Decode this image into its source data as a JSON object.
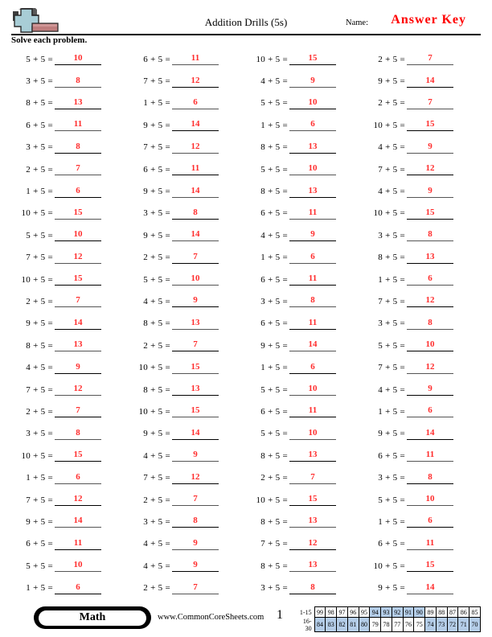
{
  "header": {
    "title": "Addition Drills (5s)",
    "name_label": "Name:",
    "name_value": "Answer Key",
    "instruction": "Solve each problem.",
    "logo_icon": "plus-block-icon",
    "answer_color": "#ff2d2d"
  },
  "problems": [
    {
      "q": "5 + 5 =",
      "a": "10"
    },
    {
      "q": "3 + 5 =",
      "a": "8"
    },
    {
      "q": "8 + 5 =",
      "a": "13"
    },
    {
      "q": "6 + 5 =",
      "a": "11"
    },
    {
      "q": "3 + 5 =",
      "a": "8"
    },
    {
      "q": "2 + 5 =",
      "a": "7"
    },
    {
      "q": "1 + 5 =",
      "a": "6"
    },
    {
      "q": "10 + 5 =",
      "a": "15"
    },
    {
      "q": "5 + 5 =",
      "a": "10"
    },
    {
      "q": "7 + 5 =",
      "a": "12"
    },
    {
      "q": "10 + 5 =",
      "a": "15"
    },
    {
      "q": "2 + 5 =",
      "a": "7"
    },
    {
      "q": "9 + 5 =",
      "a": "14"
    },
    {
      "q": "8 + 5 =",
      "a": "13"
    },
    {
      "q": "4 + 5 =",
      "a": "9"
    },
    {
      "q": "7 + 5 =",
      "a": "12"
    },
    {
      "q": "2 + 5 =",
      "a": "7"
    },
    {
      "q": "3 + 5 =",
      "a": "8"
    },
    {
      "q": "10 + 5 =",
      "a": "15"
    },
    {
      "q": "1 + 5 =",
      "a": "6"
    },
    {
      "q": "7 + 5 =",
      "a": "12"
    },
    {
      "q": "9 + 5 =",
      "a": "14"
    },
    {
      "q": "6 + 5 =",
      "a": "11"
    },
    {
      "q": "5 + 5 =",
      "a": "10"
    },
    {
      "q": "1 + 5 =",
      "a": "6"
    },
    {
      "q": "6 + 5 =",
      "a": "11"
    },
    {
      "q": "7 + 5 =",
      "a": "12"
    },
    {
      "q": "1 + 5 =",
      "a": "6"
    },
    {
      "q": "9 + 5 =",
      "a": "14"
    },
    {
      "q": "7 + 5 =",
      "a": "12"
    },
    {
      "q": "6 + 5 =",
      "a": "11"
    },
    {
      "q": "9 + 5 =",
      "a": "14"
    },
    {
      "q": "3 + 5 =",
      "a": "8"
    },
    {
      "q": "9 + 5 =",
      "a": "14"
    },
    {
      "q": "2 + 5 =",
      "a": "7"
    },
    {
      "q": "5 + 5 =",
      "a": "10"
    },
    {
      "q": "4 + 5 =",
      "a": "9"
    },
    {
      "q": "8 + 5 =",
      "a": "13"
    },
    {
      "q": "2 + 5 =",
      "a": "7"
    },
    {
      "q": "10 + 5 =",
      "a": "15"
    },
    {
      "q": "8 + 5 =",
      "a": "13"
    },
    {
      "q": "10 + 5 =",
      "a": "15"
    },
    {
      "q": "9 + 5 =",
      "a": "14"
    },
    {
      "q": "4 + 5 =",
      "a": "9"
    },
    {
      "q": "7 + 5 =",
      "a": "12"
    },
    {
      "q": "2 + 5 =",
      "a": "7"
    },
    {
      "q": "3 + 5 =",
      "a": "8"
    },
    {
      "q": "4 + 5 =",
      "a": "9"
    },
    {
      "q": "4 + 5 =",
      "a": "9"
    },
    {
      "q": "2 + 5 =",
      "a": "7"
    },
    {
      "q": "10 + 5 =",
      "a": "15"
    },
    {
      "q": "4 + 5 =",
      "a": "9"
    },
    {
      "q": "5 + 5 =",
      "a": "10"
    },
    {
      "q": "1 + 5 =",
      "a": "6"
    },
    {
      "q": "8 + 5 =",
      "a": "13"
    },
    {
      "q": "5 + 5 =",
      "a": "10"
    },
    {
      "q": "8 + 5 =",
      "a": "13"
    },
    {
      "q": "6 + 5 =",
      "a": "11"
    },
    {
      "q": "4 + 5 =",
      "a": "9"
    },
    {
      "q": "1 + 5 =",
      "a": "6"
    },
    {
      "q": "6 + 5 =",
      "a": "11"
    },
    {
      "q": "3 + 5 =",
      "a": "8"
    },
    {
      "q": "6 + 5 =",
      "a": "11"
    },
    {
      "q": "9 + 5 =",
      "a": "14"
    },
    {
      "q": "1 + 5 =",
      "a": "6"
    },
    {
      "q": "5 + 5 =",
      "a": "10"
    },
    {
      "q": "6 + 5 =",
      "a": "11"
    },
    {
      "q": "5 + 5 =",
      "a": "10"
    },
    {
      "q": "8 + 5 =",
      "a": "13"
    },
    {
      "q": "2 + 5 =",
      "a": "7"
    },
    {
      "q": "10 + 5 =",
      "a": "15"
    },
    {
      "q": "8 + 5 =",
      "a": "13"
    },
    {
      "q": "7 + 5 =",
      "a": "12"
    },
    {
      "q": "8 + 5 =",
      "a": "13"
    },
    {
      "q": "3 + 5 =",
      "a": "8"
    },
    {
      "q": "2 + 5 =",
      "a": "7"
    },
    {
      "q": "9 + 5 =",
      "a": "14"
    },
    {
      "q": "2 + 5 =",
      "a": "7"
    },
    {
      "q": "10 + 5 =",
      "a": "15"
    },
    {
      "q": "4 + 5 =",
      "a": "9"
    },
    {
      "q": "7 + 5 =",
      "a": "12"
    },
    {
      "q": "4 + 5 =",
      "a": "9"
    },
    {
      "q": "10 + 5 =",
      "a": "15"
    },
    {
      "q": "3 + 5 =",
      "a": "8"
    },
    {
      "q": "8 + 5 =",
      "a": "13"
    },
    {
      "q": "1 + 5 =",
      "a": "6"
    },
    {
      "q": "7 + 5 =",
      "a": "12"
    },
    {
      "q": "3 + 5 =",
      "a": "8"
    },
    {
      "q": "5 + 5 =",
      "a": "10"
    },
    {
      "q": "7 + 5 =",
      "a": "12"
    },
    {
      "q": "4 + 5 =",
      "a": "9"
    },
    {
      "q": "1 + 5 =",
      "a": "6"
    },
    {
      "q": "9 + 5 =",
      "a": "14"
    },
    {
      "q": "6 + 5 =",
      "a": "11"
    },
    {
      "q": "3 + 5 =",
      "a": "8"
    },
    {
      "q": "5 + 5 =",
      "a": "10"
    },
    {
      "q": "1 + 5 =",
      "a": "6"
    },
    {
      "q": "6 + 5 =",
      "a": "11"
    },
    {
      "q": "10 + 5 =",
      "a": "15"
    },
    {
      "q": "9 + 5 =",
      "a": "14"
    }
  ],
  "footer": {
    "subject_badge": "Math",
    "website": "www.CommonCoreSheets.com",
    "page_number": "1",
    "highlight_color": "#b4cde8",
    "score_rows": [
      {
        "label": "1-15",
        "cells": [
          {
            "v": "99",
            "hl": false
          },
          {
            "v": "98",
            "hl": false
          },
          {
            "v": "97",
            "hl": false
          },
          {
            "v": "96",
            "hl": false
          },
          {
            "v": "95",
            "hl": false
          },
          {
            "v": "94",
            "hl": true
          },
          {
            "v": "93",
            "hl": true
          },
          {
            "v": "92",
            "hl": true
          },
          {
            "v": "91",
            "hl": true
          },
          {
            "v": "90",
            "hl": true
          },
          {
            "v": "89",
            "hl": false
          },
          {
            "v": "88",
            "hl": false
          },
          {
            "v": "87",
            "hl": false
          },
          {
            "v": "86",
            "hl": false
          },
          {
            "v": "85",
            "hl": false
          }
        ]
      },
      {
        "label": "16-30",
        "cells": [
          {
            "v": "84",
            "hl": true
          },
          {
            "v": "83",
            "hl": true
          },
          {
            "v": "82",
            "hl": true
          },
          {
            "v": "81",
            "hl": true
          },
          {
            "v": "80",
            "hl": true
          },
          {
            "v": "79",
            "hl": false
          },
          {
            "v": "78",
            "hl": false
          },
          {
            "v": "77",
            "hl": false
          },
          {
            "v": "76",
            "hl": false
          },
          {
            "v": "75",
            "hl": false
          },
          {
            "v": "74",
            "hl": true
          },
          {
            "v": "73",
            "hl": true
          },
          {
            "v": "72",
            "hl": true
          },
          {
            "v": "71",
            "hl": true
          },
          {
            "v": "70",
            "hl": true
          }
        ]
      }
    ]
  }
}
